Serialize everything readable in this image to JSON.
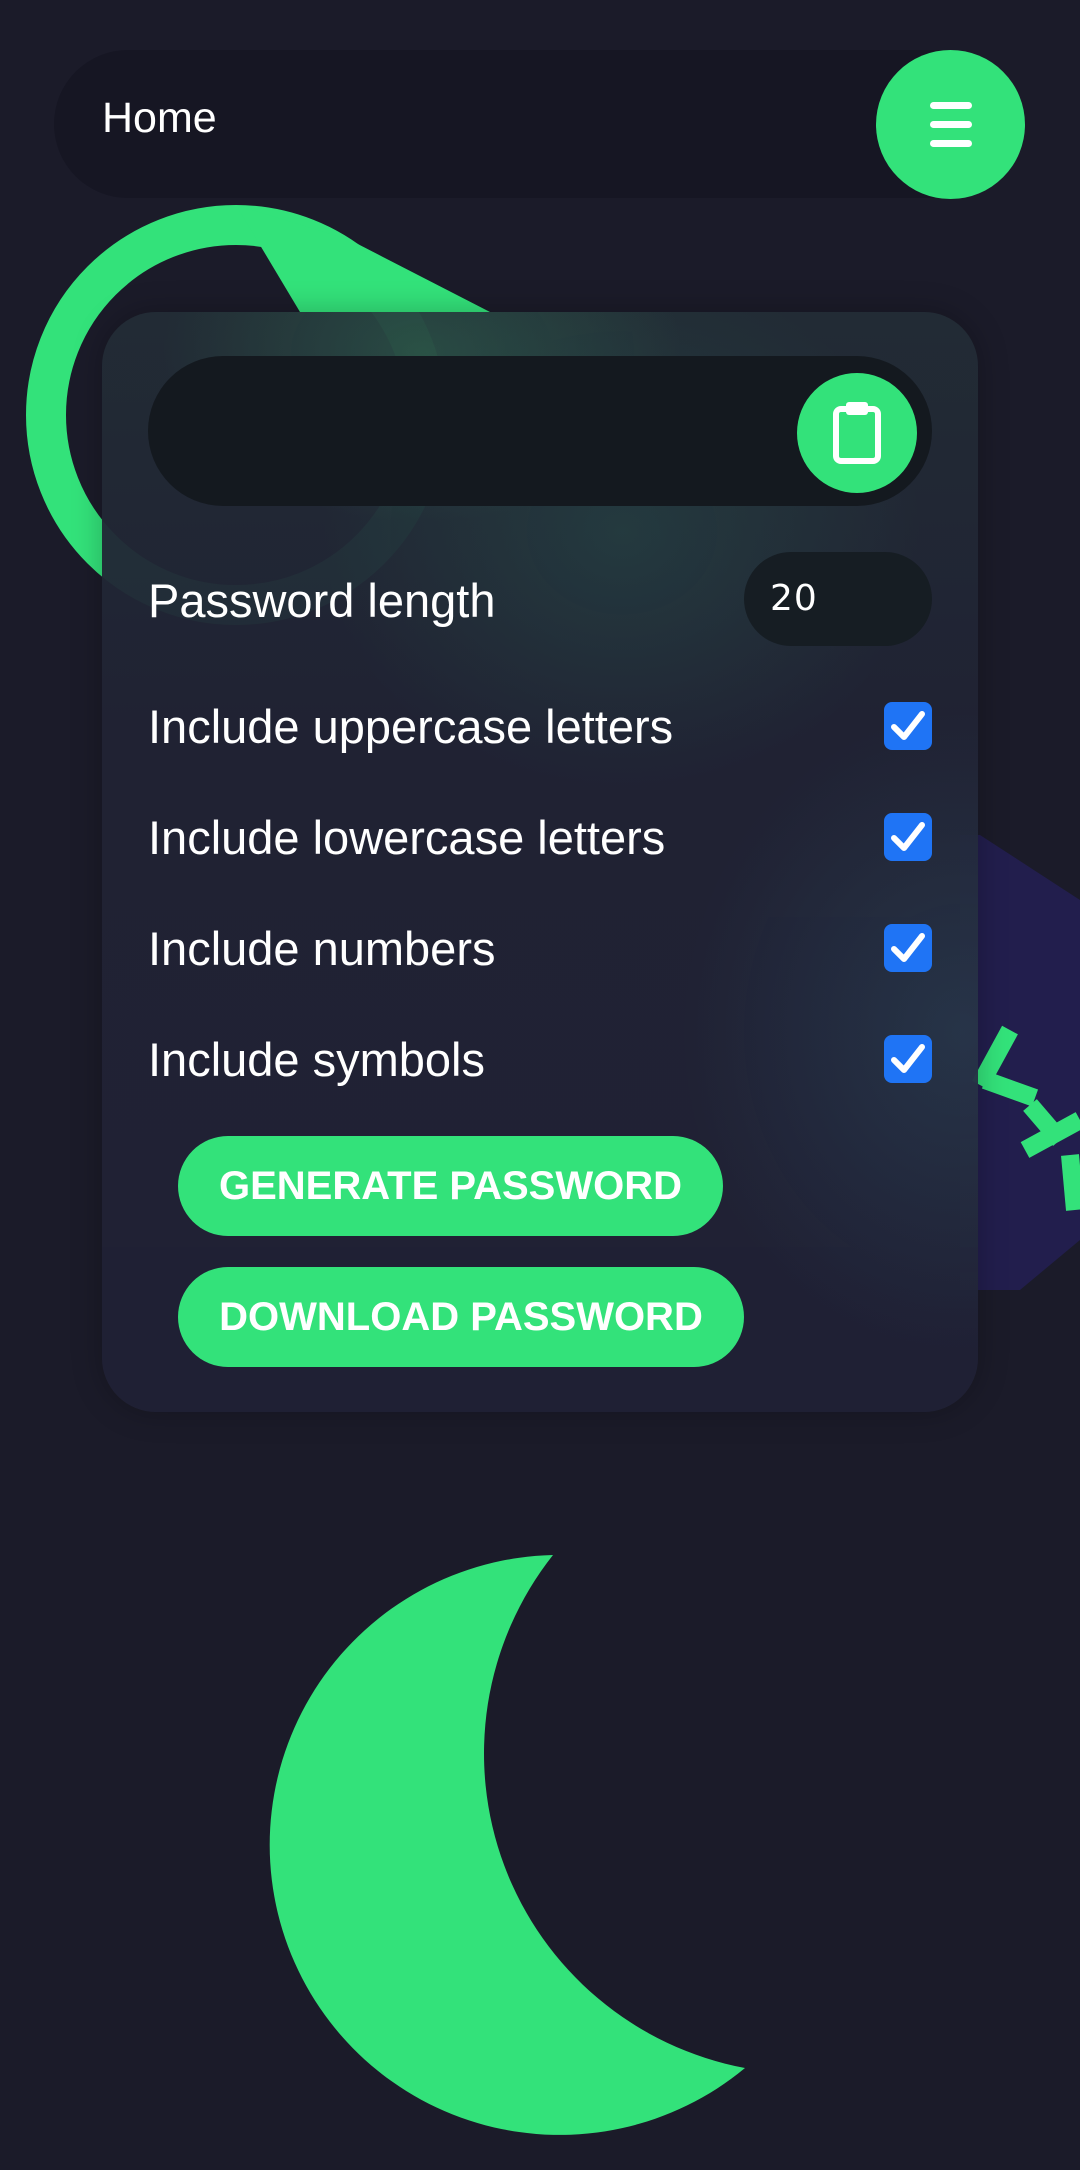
{
  "navbar": {
    "title": "Home",
    "menu_icon": "menu-icon"
  },
  "generator": {
    "password_value": "",
    "copy_icon": "clipboard-icon",
    "length_label": "Password length",
    "length_value": "20",
    "options": [
      {
        "label": "Include uppercase letters",
        "checked": true
      },
      {
        "label": "Include lowercase letters",
        "checked": true
      },
      {
        "label": "Include numbers",
        "checked": true
      },
      {
        "label": "Include symbols",
        "checked": true
      }
    ],
    "generate_label": "GENERATE PASSWORD",
    "download_label": "DOWNLOAD PASSWORD"
  },
  "colors": {
    "background": "#1b1b29",
    "accent": "#33e27a",
    "checkbox": "#1f74f5",
    "card": "#20223a"
  }
}
